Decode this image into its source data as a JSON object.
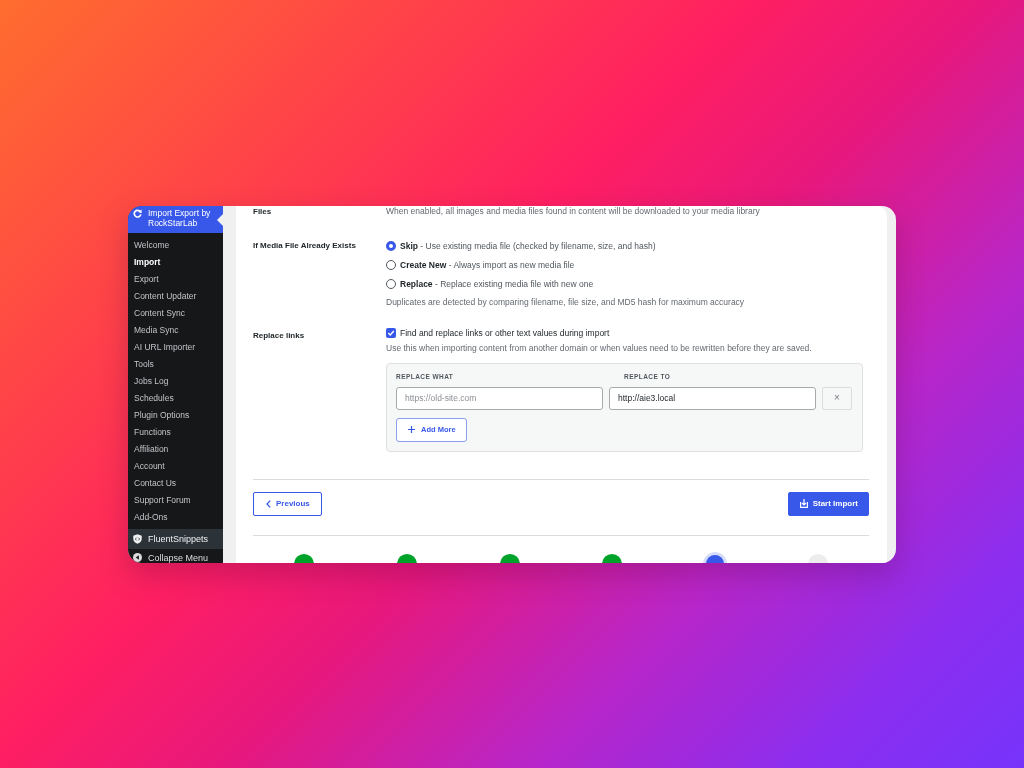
{
  "sidebar": {
    "plugin_title": "Import Export by RockStarLab",
    "items": [
      {
        "label": "Welcome",
        "selected": false
      },
      {
        "label": "Import",
        "selected": true
      },
      {
        "label": "Export",
        "selected": false
      },
      {
        "label": "Content Updater",
        "selected": false
      },
      {
        "label": "Content Sync",
        "selected": false
      },
      {
        "label": "Media Sync",
        "selected": false
      },
      {
        "label": "AI URL Importer",
        "selected": false
      },
      {
        "label": "Tools",
        "selected": false
      },
      {
        "label": "Jobs Log",
        "selected": false
      },
      {
        "label": "Schedules",
        "selected": false
      },
      {
        "label": "Plugin Options",
        "selected": false
      },
      {
        "label": "Functions",
        "selected": false
      },
      {
        "label": "Affiliation",
        "selected": false
      },
      {
        "label": "Account",
        "selected": false
      },
      {
        "label": "Contact Us",
        "selected": false
      },
      {
        "label": "Support Forum",
        "selected": false
      },
      {
        "label": "Add-Ons",
        "selected": false
      }
    ],
    "snippets_item": "FluentSnippets",
    "collapse_item": "Collapse Menu"
  },
  "settings": [
    {
      "kind": "text",
      "label": "Files",
      "description": "When enabled, all images and media files found in content will be downloaded to your media library"
    },
    {
      "kind": "radio",
      "label": "If Media File Already Exists",
      "options": [
        {
          "text": "**Skip** - Use existing media file (checked by filename, size, and hash)",
          "selected": true
        },
        {
          "text": "**Create New** - Always import as new media file",
          "selected": false
        },
        {
          "text": "**Replace** - Replace existing media file with new one",
          "selected": false
        }
      ],
      "note": "Duplicates are detected by comparing filename, file size, and MD5 hash for maximum accuracy"
    },
    {
      "kind": "replace",
      "label": "Replace links",
      "checkbox": {
        "text": "Find and replace links or other text values during import",
        "checked": true
      },
      "help": "Use this when importing content from another domain or when values need to be rewritten before they are saved.",
      "table": {
        "columns": [
          "REPLACE WHAT",
          "REPLACE TO"
        ],
        "rows": [
          {
            "from": {
              "placeholder": "https://old-site.com"
            },
            "to": {
              "value": "http://aie3.local"
            },
            "remove": "×"
          }
        ],
        "add_button": "Add More"
      }
    }
  ],
  "footer": {
    "previous": "Previous",
    "start": "Start Import"
  },
  "steps": [
    {
      "kind": "done"
    },
    {
      "kind": "done"
    },
    {
      "kind": "done"
    },
    {
      "kind": "done"
    },
    {
      "kind": "current"
    },
    {
      "kind": "pending"
    }
  ]
}
